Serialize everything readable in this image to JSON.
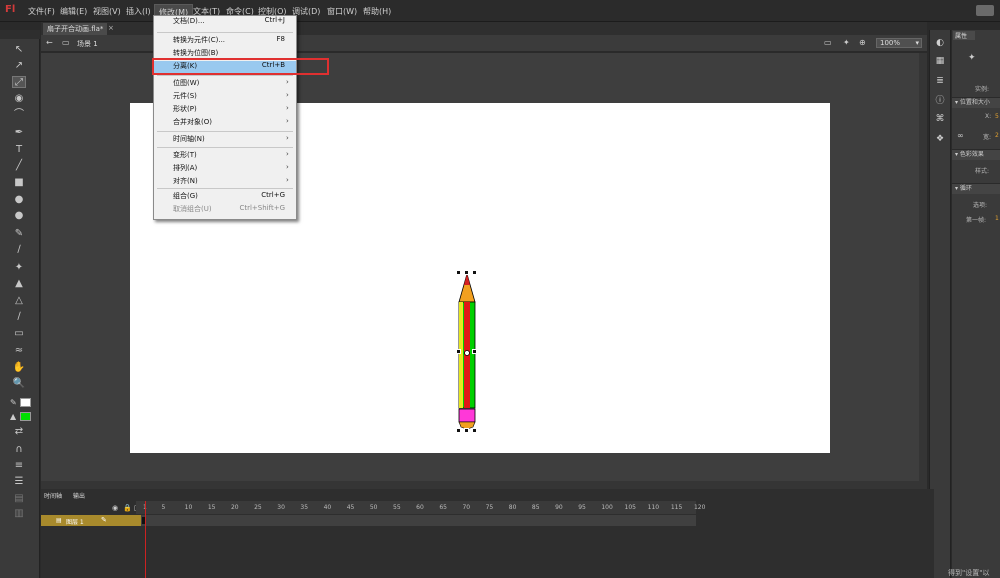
{
  "app": {
    "logo": "Fl"
  },
  "menubar": {
    "items": [
      "文件(F)",
      "编辑(E)",
      "视图(V)",
      "插入(I)",
      "修改(M)",
      "文本(T)",
      "命令(C)",
      "控制(O)",
      "调试(D)",
      "窗口(W)",
      "帮助(H)"
    ]
  },
  "document": {
    "tab": "扇子开合动画.fla*",
    "scene": "场景 1",
    "zoom": "100%"
  },
  "modify_menu": {
    "groups": [
      [
        {
          "label": "文档(D)...",
          "shortcut": "Ctrl+J"
        }
      ],
      [
        {
          "label": "转换为元件(C)...",
          "shortcut": "F8"
        },
        {
          "label": "转换为位图(B)",
          "shortcut": ""
        },
        {
          "label": "分离(K)",
          "shortcut": "Ctrl+B",
          "highlighted": true
        }
      ],
      [
        {
          "label": "位图(W)",
          "submenu": true
        },
        {
          "label": "元件(S)",
          "submenu": true
        },
        {
          "label": "形状(P)",
          "submenu": true
        },
        {
          "label": "合并对象(O)",
          "submenu": true
        }
      ],
      [
        {
          "label": "时间轴(N)",
          "submenu": true
        }
      ],
      [
        {
          "label": "变形(T)",
          "submenu": true
        },
        {
          "label": "排列(A)",
          "submenu": true
        },
        {
          "label": "对齐(N)",
          "submenu": true
        }
      ],
      [
        {
          "label": "组合(G)",
          "shortcut": "Ctrl+G"
        },
        {
          "label": "取消组合(U)",
          "shortcut": "Ctrl+Shift+G",
          "disabled": true
        }
      ]
    ]
  },
  "properties": {
    "tab": "属性",
    "instance_label": "实例:",
    "section_position": "位置和大小",
    "x_label": "X:",
    "x_value": "5",
    "w_label": "宽:",
    "w_value": "2",
    "section_color": "色彩效果",
    "style_label": "样式:",
    "section_loop": "循环",
    "options_label": "选项:",
    "first_frame_label": "第一帧:",
    "first_frame_value": "1"
  },
  "timeline": {
    "tabs": [
      "时间轴",
      "输出"
    ],
    "layer_name": "图层 1",
    "frame_ticks": [
      "1",
      "5",
      "10",
      "15",
      "20",
      "25",
      "30",
      "35",
      "40",
      "45",
      "50",
      "55",
      "60",
      "65",
      "70",
      "75",
      "80",
      "85",
      "90",
      "95",
      "100",
      "105",
      "110",
      "115",
      "120"
    ]
  },
  "watermark": "得到\"设置\"以",
  "colors": {
    "stroke": "#000000",
    "fill": "#00ff00",
    "highlight": "#99c9ef",
    "annotation": "#e03030"
  }
}
